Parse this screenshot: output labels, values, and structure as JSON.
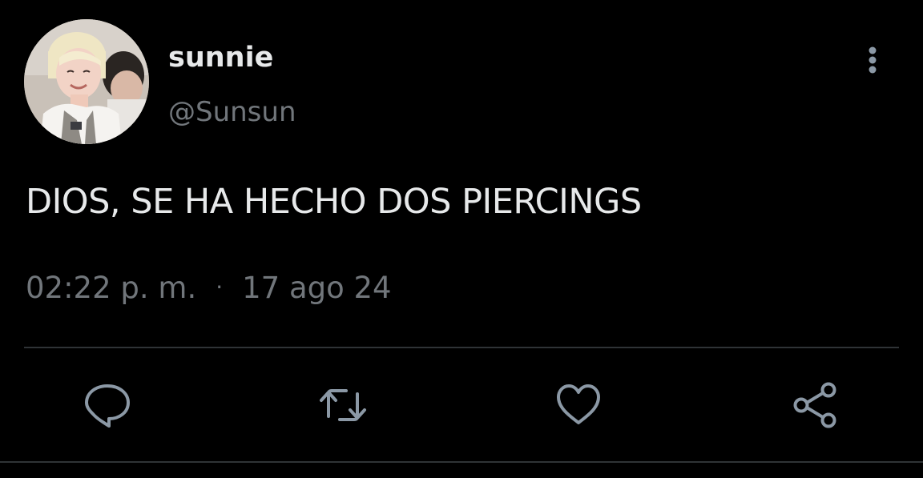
{
  "tweet": {
    "author": {
      "display_name": "sunnie",
      "handle": "@Sunsun"
    },
    "text": "DIOS, SE HA HECHO DOS PIERCINGS",
    "time": "02:22 p. m.",
    "separator": "·",
    "date": "17 ago 24"
  },
  "actions": {
    "reply_icon": "speech-bubble-icon",
    "retweet_icon": "retweet-arrows-icon",
    "like_icon": "heart-outline-icon",
    "share_icon": "share-nodes-icon",
    "more_icon": "vertical-dots-icon"
  },
  "colors": {
    "background": "#000000",
    "primary_text": "#e7e9ea",
    "secondary_text": "#71767b",
    "divider": "#2f3336"
  }
}
